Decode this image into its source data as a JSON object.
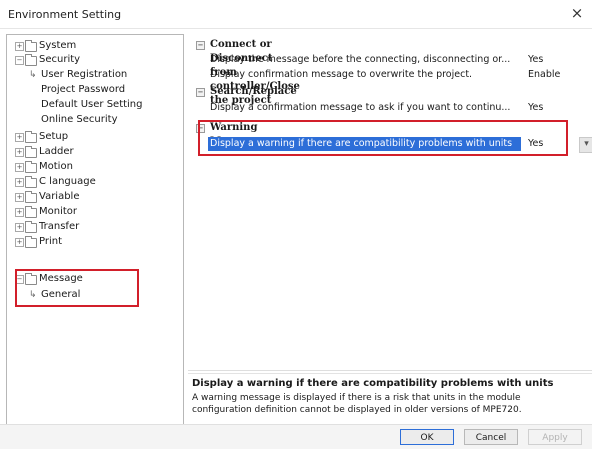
{
  "window": {
    "title": "Environment Setting",
    "close_label": "×"
  },
  "tree": {
    "system": "System",
    "security": "Security",
    "user_registration": "User Registration",
    "project_password": "Project Password",
    "default_user_setting": "Default User Setting",
    "online_security": "Online Security",
    "setup": "Setup",
    "ladder": "Ladder",
    "motion": "Motion",
    "c_language": "C language",
    "variable": "Variable",
    "monitor": "Monitor",
    "transfer": "Transfer",
    "print": "Print",
    "message": "Message",
    "general": "General"
  },
  "sections": {
    "connect": {
      "title": "Connect or Disconnect from controller/Close the project",
      "row1_label": "Display the message before the connecting, disconnecting or...",
      "row1_value": "Yes",
      "row2_label": "Display confirmation message to overwrite the project.",
      "row2_value": "Enable"
    },
    "search": {
      "title": "Search/Replace",
      "row1_label": "Display a confirmation message to ask if you want to continu...",
      "row1_value": "Yes"
    },
    "warning": {
      "title": "Warning Message",
      "row1_label": "Display a warning if there are compatibility problems with units",
      "row1_value": "Yes"
    }
  },
  "description": {
    "title": "Display a warning if there are compatibility problems with units",
    "text": "A warning message is displayed if there is a risk that units in the module configuration definition cannot be displayed in older versions of MPE720."
  },
  "footer": {
    "ok": "OK",
    "cancel": "Cancel",
    "apply": "Apply"
  },
  "colors": {
    "selection": "#2d6ed8",
    "highlight_box": "#d21f2a"
  }
}
